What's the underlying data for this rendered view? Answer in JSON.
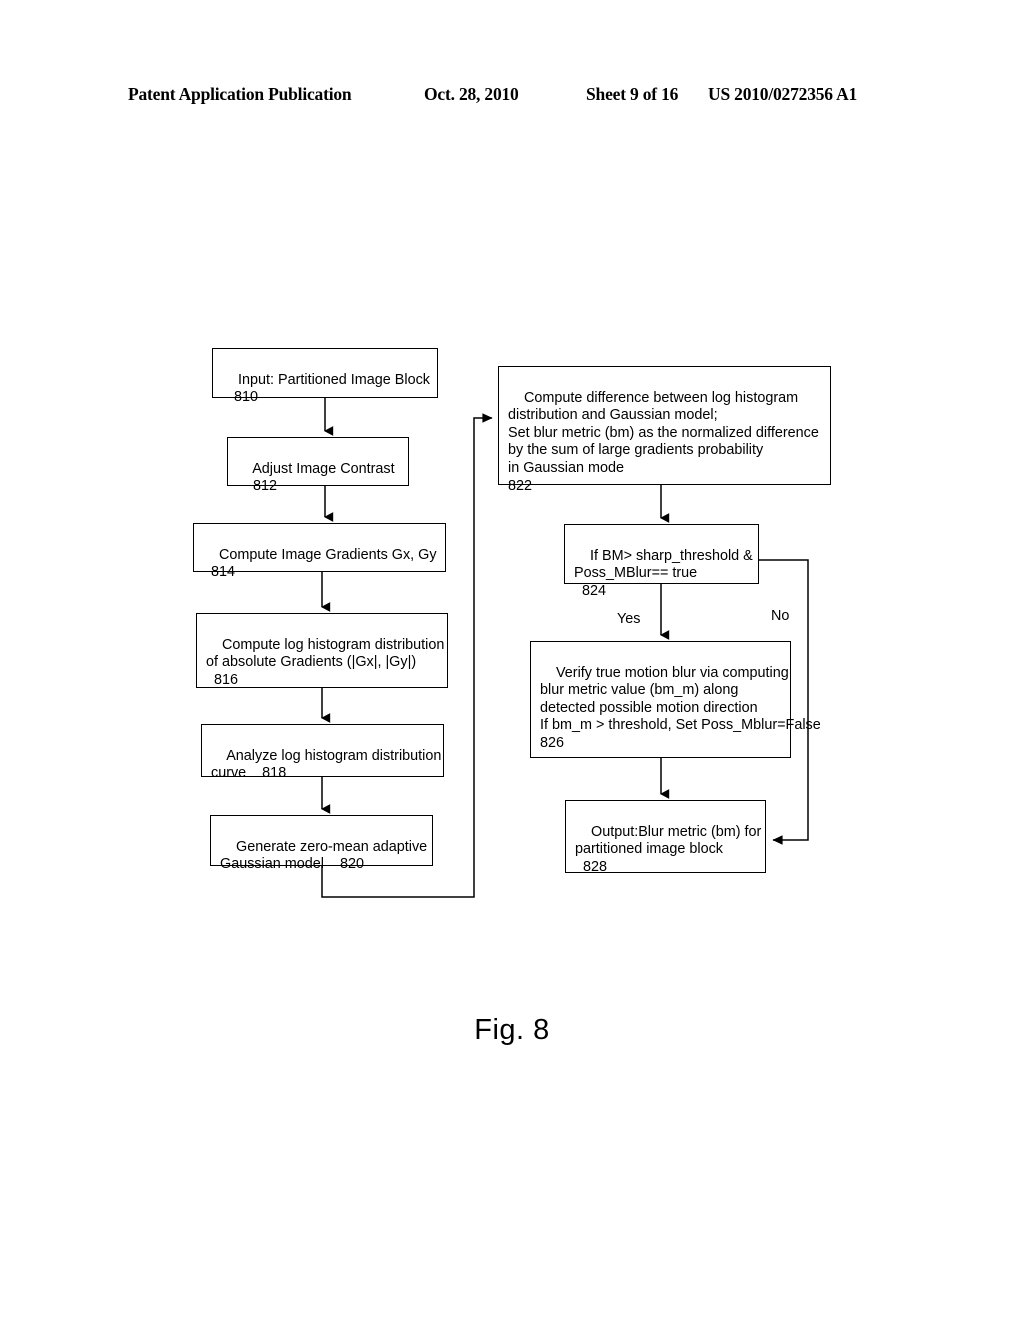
{
  "header": {
    "publication": "Patent Application Publication",
    "date": "Oct. 28, 2010",
    "sheet": "Sheet 9 of 16",
    "patent_number": "US 2010/0272356 A1"
  },
  "figure": {
    "caption": "Fig. 8"
  },
  "flowchart": {
    "nodes": {
      "n810": {
        "id": "810",
        "text": "Input: Partitioned Image Block\n   810"
      },
      "n812": {
        "id": "812",
        "text": "Adjust Image Contrast\n    812"
      },
      "n814": {
        "id": "814",
        "text": "Compute Image Gradients Gx, Gy\n  814"
      },
      "n816": {
        "id": "816",
        "text": "Compute log histogram distribution\nof absolute Gradients (|Gx|, |Gy|)\n  816"
      },
      "n818": {
        "id": "818",
        "text": "Analyze log histogram distribution\ncurve    818"
      },
      "n820": {
        "id": "820",
        "text": "Generate zero-mean adaptive\nGaussian model    820"
      },
      "n822": {
        "id": "822",
        "text": "Compute difference between log histogram\ndistribution and Gaussian model;\nSet blur metric (bm) as the normalized difference\nby the sum of large gradients probability\nin Gaussian mode\n822"
      },
      "n824": {
        "id": "824",
        "text": "If BM> sharp_threshold &\nPoss_MBlur== true\n  824"
      },
      "n826": {
        "id": "826",
        "text": "Verify true motion blur via computing\nblur metric value (bm_m) along\ndetected possible motion direction\nIf bm_m > threshold, Set Poss_Mblur=False\n826"
      },
      "n828": {
        "id": "828",
        "text": "Output:Blur metric (bm) for\npartitioned image block\n  828"
      }
    },
    "edge_labels": {
      "yes": "Yes",
      "no": "No"
    }
  },
  "colors": {
    "line": "#000000",
    "background": "#ffffff",
    "text": "#000000"
  }
}
